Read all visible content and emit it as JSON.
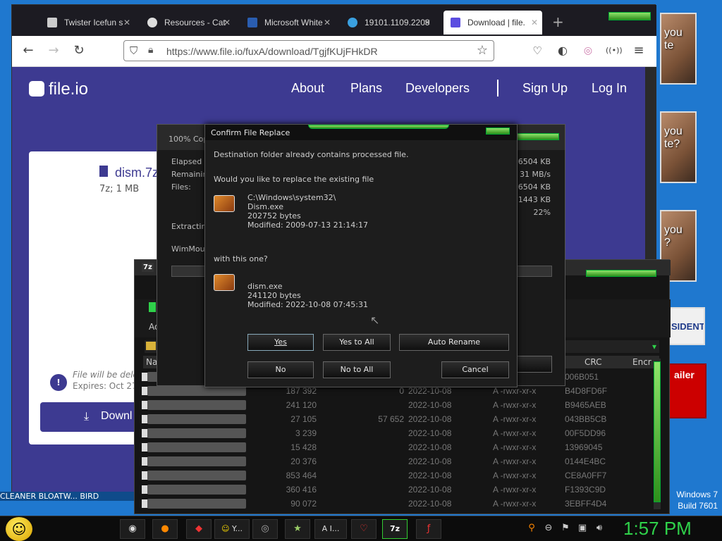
{
  "browser": {
    "tabs": [
      {
        "label": "Twister Icefun s",
        "icon": "bank-icon"
      },
      {
        "label": "Resources - Cat",
        "icon": "cat-icon"
      },
      {
        "label": "Microsoft White",
        "icon": "flag-icon"
      },
      {
        "label": "19101.1109.2209",
        "icon": "edge-icon"
      },
      {
        "label": "Download | file.",
        "icon": "fileio-icon"
      }
    ],
    "new_tab": "+",
    "url": "https://www.file.io/fuxA/download/TgjfKUjFHkDR"
  },
  "site": {
    "logo": "file.io",
    "nav": [
      "About",
      "Plans",
      "Developers",
      "Sign Up",
      "Log In"
    ],
    "file_name": "dism.7z",
    "file_meta": "7z; 1 MB",
    "notice_line1": "File will be dele",
    "notice_line2": "Expires: Oct 27,",
    "download_label": "Downl"
  },
  "progress": {
    "title": "100% Cop",
    "labels": [
      "Elapsed ti",
      "Remainin",
      "Files:"
    ],
    "values": [
      "6504 KB",
      "31 MB/s",
      "6504 KB",
      "1443 KB",
      "22%"
    ],
    "extracting": "Extracting",
    "current": "WimMoun"
  },
  "dialog": {
    "title": "Confirm File Replace",
    "line1": "Destination folder already contains processed file.",
    "line2": "Would you like to replace the existing file",
    "existing_path": "C:\\Windows\\system32\\",
    "existing_name": "Dism.exe",
    "existing_size": "202752 bytes",
    "existing_modified": "Modified: 2009-07-13 21:14:17",
    "with_this": "with this one?",
    "new_name": "dism.exe",
    "new_size": "241120 bytes",
    "new_modified": "Modified: 2022-10-08 07:45:31",
    "buttons": {
      "yes": "Yes",
      "yes_all": "Yes to All",
      "auto_rename": "Auto Rename",
      "no": "No",
      "no_all": "No to All",
      "cancel": "Cancel"
    }
  },
  "filemanager": {
    "app_badge": "7z",
    "add_label": "Ad",
    "col_name": "Na",
    "col_crc": "CRC",
    "col_encr": "Encr",
    "rows": [
      {
        "size": "",
        "packed": "",
        "date": "",
        "attr": "",
        "crc": "006B051"
      },
      {
        "size": "187 392",
        "packed": "0",
        "date": "2022-10-08",
        "attr": "A -rwxr-xr-x",
        "crc": "B4D8FD6F"
      },
      {
        "size": "241 120",
        "packed": "",
        "date": "2022-10-08",
        "attr": "A -rwxr-xr-x",
        "crc": "B9465AEB"
      },
      {
        "size": "27 105",
        "packed": "57 652",
        "date": "2022-10-08",
        "attr": "A -rwxr-xr-x",
        "crc": "043BB5CB"
      },
      {
        "size": "3 239",
        "packed": "",
        "date": "2022-10-08",
        "attr": "A -rwxr-xr-x",
        "crc": "00F5DD96"
      },
      {
        "size": "15 428",
        "packed": "",
        "date": "2022-10-08",
        "attr": "A -rwxr-xr-x",
        "crc": "13969045"
      },
      {
        "size": "20 376",
        "packed": "",
        "date": "2022-10-08",
        "attr": "A -rwxr-xr-x",
        "crc": "0144E4BC"
      },
      {
        "size": "853 464",
        "packed": "",
        "date": "2022-10-08",
        "attr": "A -rwxr-xr-x",
        "crc": "CE8A0FF7"
      },
      {
        "size": "360 416",
        "packed": "",
        "date": "2022-10-08",
        "attr": "A -rwxr-xr-x",
        "crc": "F1393C9D"
      },
      {
        "size": "90 072",
        "packed": "",
        "date": "2022-10-08",
        "attr": "A -rwxr-xr-x",
        "crc": "3EBFF4D4"
      }
    ]
  },
  "desktop": {
    "thumb1": "you\nte",
    "thumb2": "you\nte?",
    "thumb3": "you\n?",
    "thumb4": "SIDENT",
    "thumb5": "ailer",
    "shortcuts": "CLEANER   BLOATW...   BIRD",
    "os_name": "Windows 7",
    "build": "Build 7601"
  },
  "taskbar": {
    "items": [
      "Y...",
      "I...",
      "7z"
    ],
    "clock": "1:57 PM"
  },
  "colors": {
    "accent_green": "#2fd14a",
    "fileio_purple": "#3d3a91"
  }
}
